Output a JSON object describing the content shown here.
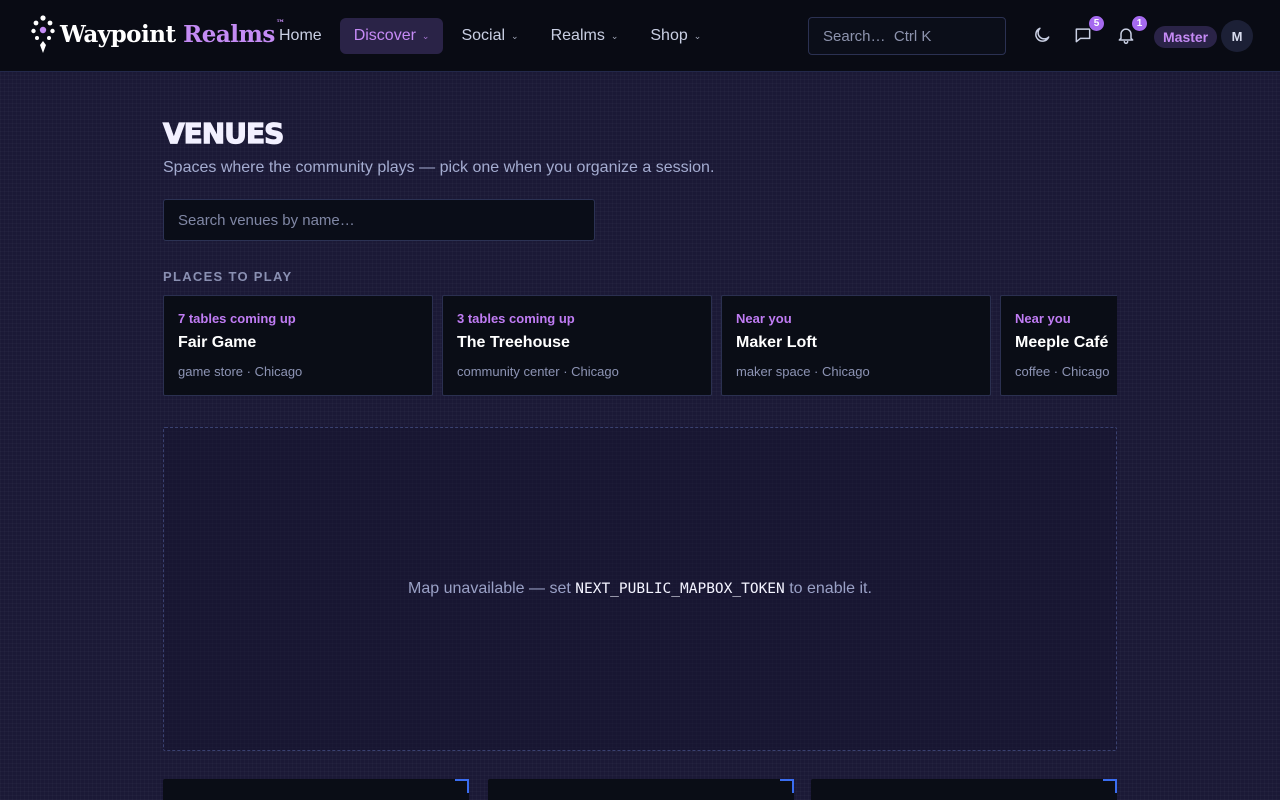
{
  "app": {
    "name_main": "Waypoint ",
    "name_accent": "Realms",
    "tm": "™"
  },
  "nav": {
    "items": [
      {
        "label": "Home",
        "has_dropdown": false,
        "active": false
      },
      {
        "label": "Discover",
        "has_dropdown": true,
        "active": true
      },
      {
        "label": "Social",
        "has_dropdown": true,
        "active": false
      },
      {
        "label": "Realms",
        "has_dropdown": true,
        "active": false
      },
      {
        "label": "Shop",
        "has_dropdown": true,
        "active": false
      }
    ]
  },
  "header": {
    "search_placeholder": "Search…  Ctrl K",
    "messages_count": "5",
    "notifications_count": "1",
    "role": "Master",
    "avatar_initial": "M",
    "icons": [
      "moon-icon",
      "chat-icon",
      "bell-icon"
    ]
  },
  "page": {
    "title": "VENUES",
    "subtitle": "Spaces where the community plays — pick one when you organize a session.",
    "search_placeholder": "Search venues by name…",
    "section_label": "PLACES TO PLAY"
  },
  "venues": [
    {
      "meta": "7 tables coming up",
      "name": "Fair Game",
      "info": "game store · Chicago"
    },
    {
      "meta": "3 tables coming up",
      "name": "The Treehouse",
      "info": "community center · Chicago"
    },
    {
      "meta": "Near you",
      "name": "Maker Loft",
      "info": "maker space · Chicago"
    },
    {
      "meta": "Near you",
      "name": "Meeple Café",
      "info": "coffee · Chicago"
    }
  ],
  "map": {
    "msg_before": "Map unavailable — set ",
    "msg_code": "NEXT_PUBLIC_MAPBOX_TOKEN",
    "msg_after": " to enable it."
  },
  "colors": {
    "accent": "#c58af5",
    "background": "#1b1936",
    "header": "#090b14",
    "badge": "#a66af0"
  }
}
